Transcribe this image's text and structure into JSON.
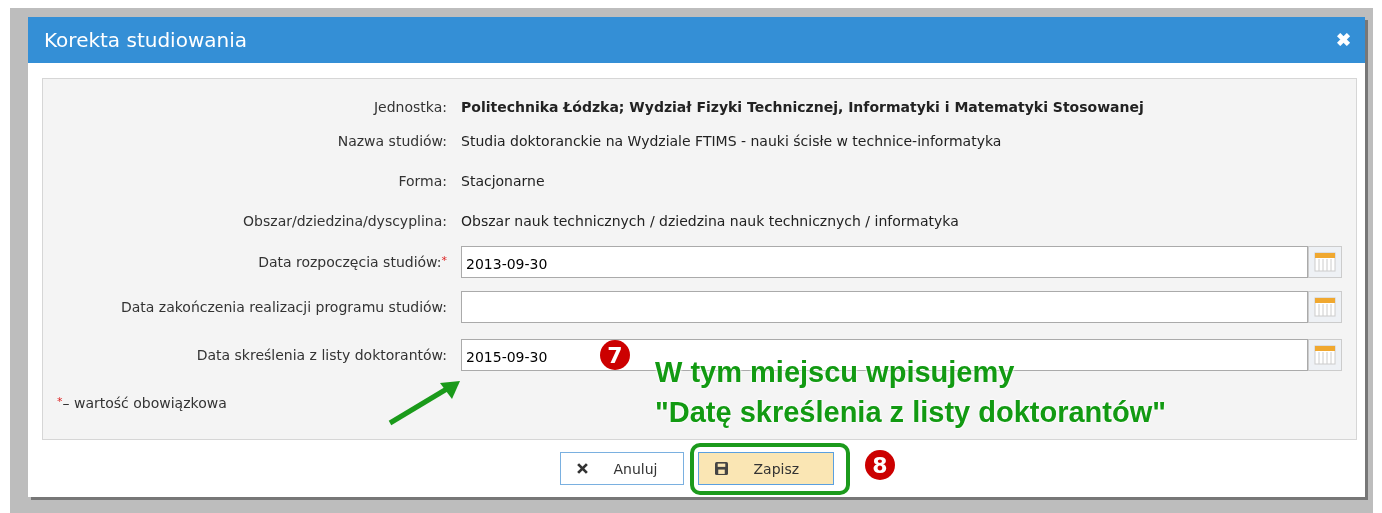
{
  "dialog": {
    "title": "Korekta studiowania",
    "close": "✖"
  },
  "info_rows": [
    {
      "label": "Jednostka:",
      "value": "Politechnika Łódzka; Wydział Fizyki Technicznej, Informatyki i Matematyki Stosowanej",
      "bold": true
    },
    {
      "label": "Nazwa studiów:",
      "value": "Studia doktoranckie na Wydziale FTIMS - nauki ścisłe w technice-informatyka",
      "bold": false
    },
    {
      "label": "Forma:",
      "value": "Stacjonarne",
      "bold": false
    },
    {
      "label": "Obszar/dziedzina/dyscyplina:",
      "value": "Obszar nauk technicznych / dziedzina nauk technicznych / informatyka",
      "bold": false
    }
  ],
  "date_fields": [
    {
      "label": "Data rozpoczęcia studiów:",
      "required_mark": "*",
      "value": "2013-09-30"
    },
    {
      "label": "Data zakończenia realizacji programu studiów:"
    },
    {
      "label": "Data skreślenia z listy doktorantów:",
      "value": "2015-09-30"
    }
  ],
  "legend": {
    "mark": "*",
    "text": "– wartość obowiązkowa"
  },
  "buttons": [
    {
      "label": "Anuluj",
      "kind": "cancel"
    },
    {
      "label": "Zapisz",
      "kind": "save"
    }
  ],
  "annotations": {
    "badges": [
      "7",
      "8"
    ],
    "callout": [
      "W tym miejscu wpisujemy",
      "\"Datę skreślenia z listy doktorantów\""
    ]
  }
}
